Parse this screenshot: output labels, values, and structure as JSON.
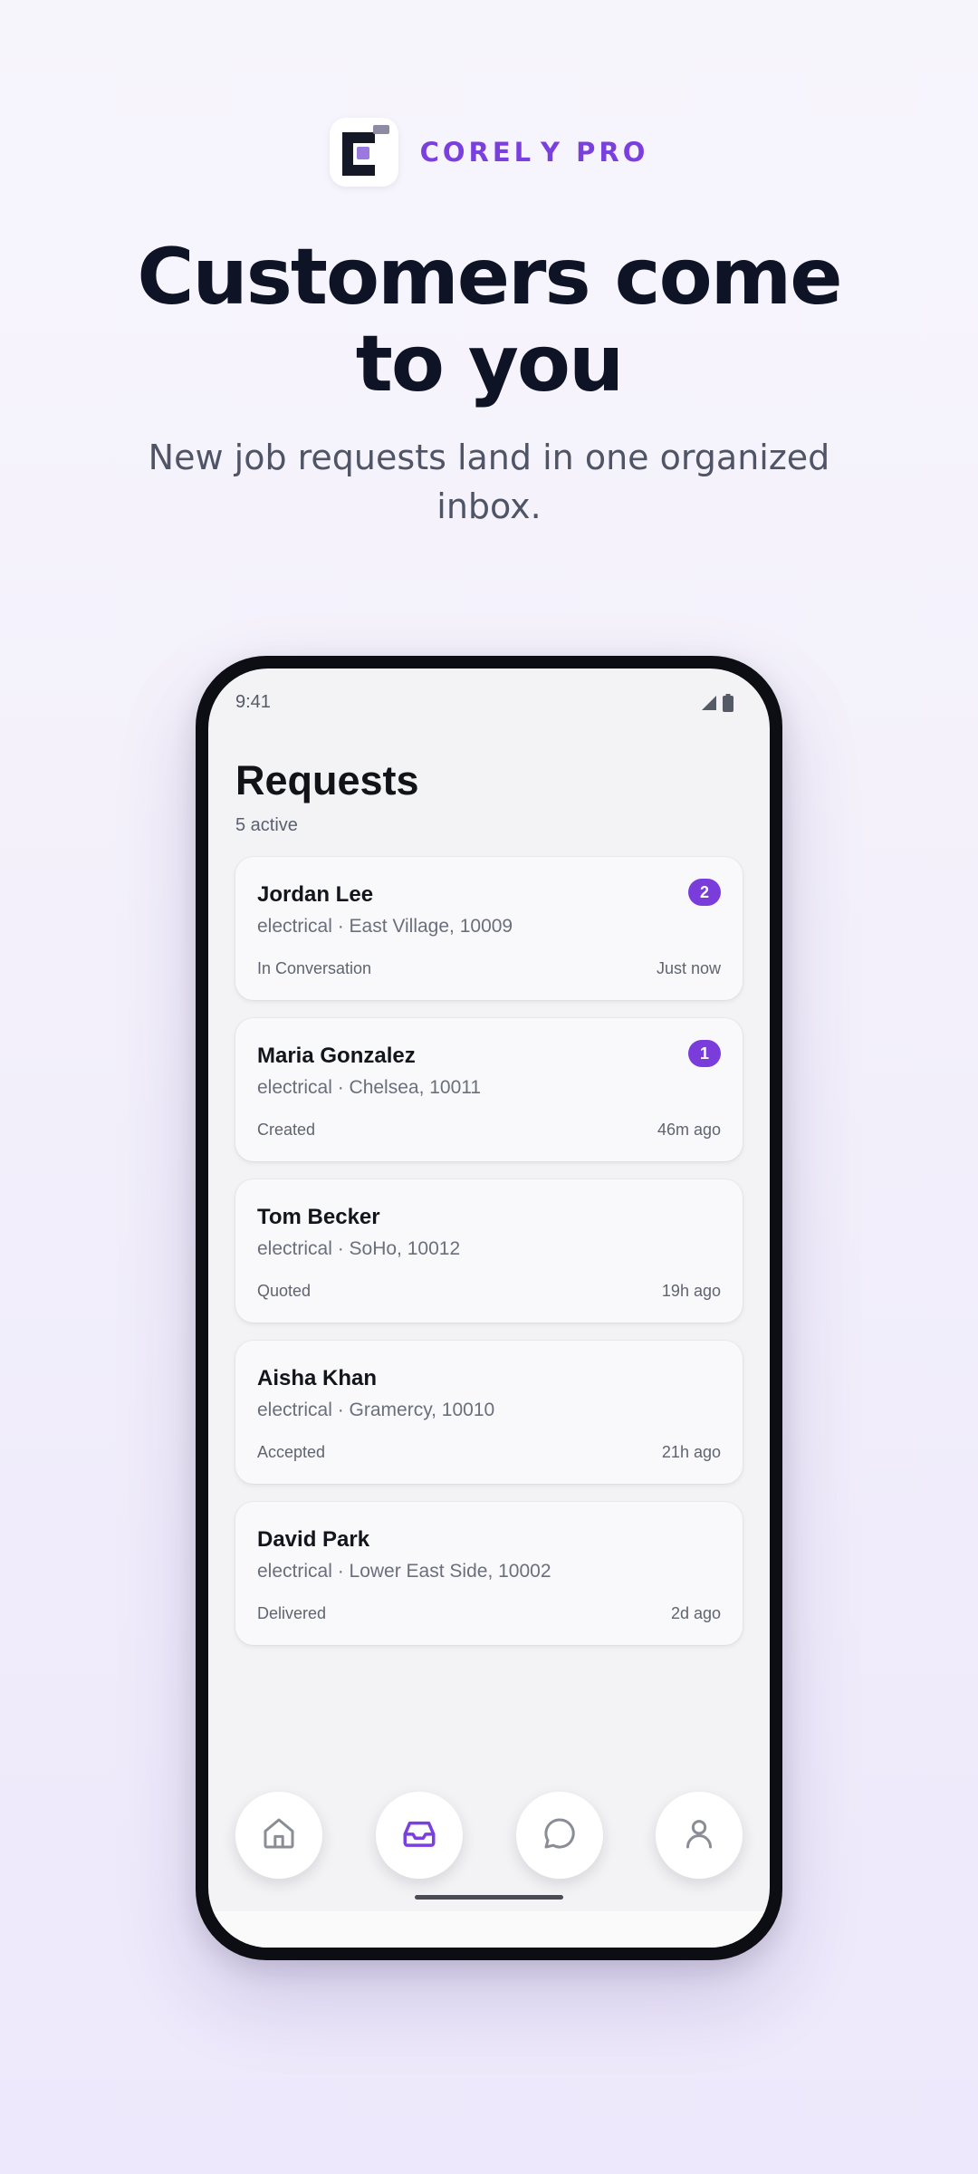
{
  "brand": {
    "name": "COREL Y PRO",
    "accent": "#7b3fe0"
  },
  "hero": {
    "headline": "Customers come to you",
    "subhead": "New job requests land in one organized inbox."
  },
  "status_bar": {
    "time": "9:41",
    "icons": [
      "signal-icon",
      "battery-icon"
    ]
  },
  "requests": {
    "title": "Requests",
    "subtitle": "5 active",
    "items": [
      {
        "name": "Jordan Lee",
        "meta": "electrical · East Village, 10009",
        "status": "In Conversation",
        "time": "Just now",
        "badge": "2"
      },
      {
        "name": "Maria Gonzalez",
        "meta": "electrical · Chelsea, 10011",
        "status": "Created",
        "time": "46m ago",
        "badge": "1"
      },
      {
        "name": "Tom Becker",
        "meta": "electrical · SoHo, 10012",
        "status": "Quoted",
        "time": "19h ago"
      },
      {
        "name": "Aisha Khan",
        "meta": "electrical · Gramercy, 10010",
        "status": "Accepted",
        "time": "21h ago"
      },
      {
        "name": "David Park",
        "meta": "electrical · Lower East Side, 10002",
        "status": "Delivered",
        "time": "2d ago"
      }
    ]
  },
  "nav": {
    "items": [
      {
        "icon": "home-icon",
        "active": false
      },
      {
        "icon": "inbox-icon",
        "active": true
      },
      {
        "icon": "chat-icon",
        "active": false
      },
      {
        "icon": "profile-icon",
        "active": false
      }
    ],
    "active_color": "#7b3fe0",
    "inactive_color": "#8a8d96"
  }
}
